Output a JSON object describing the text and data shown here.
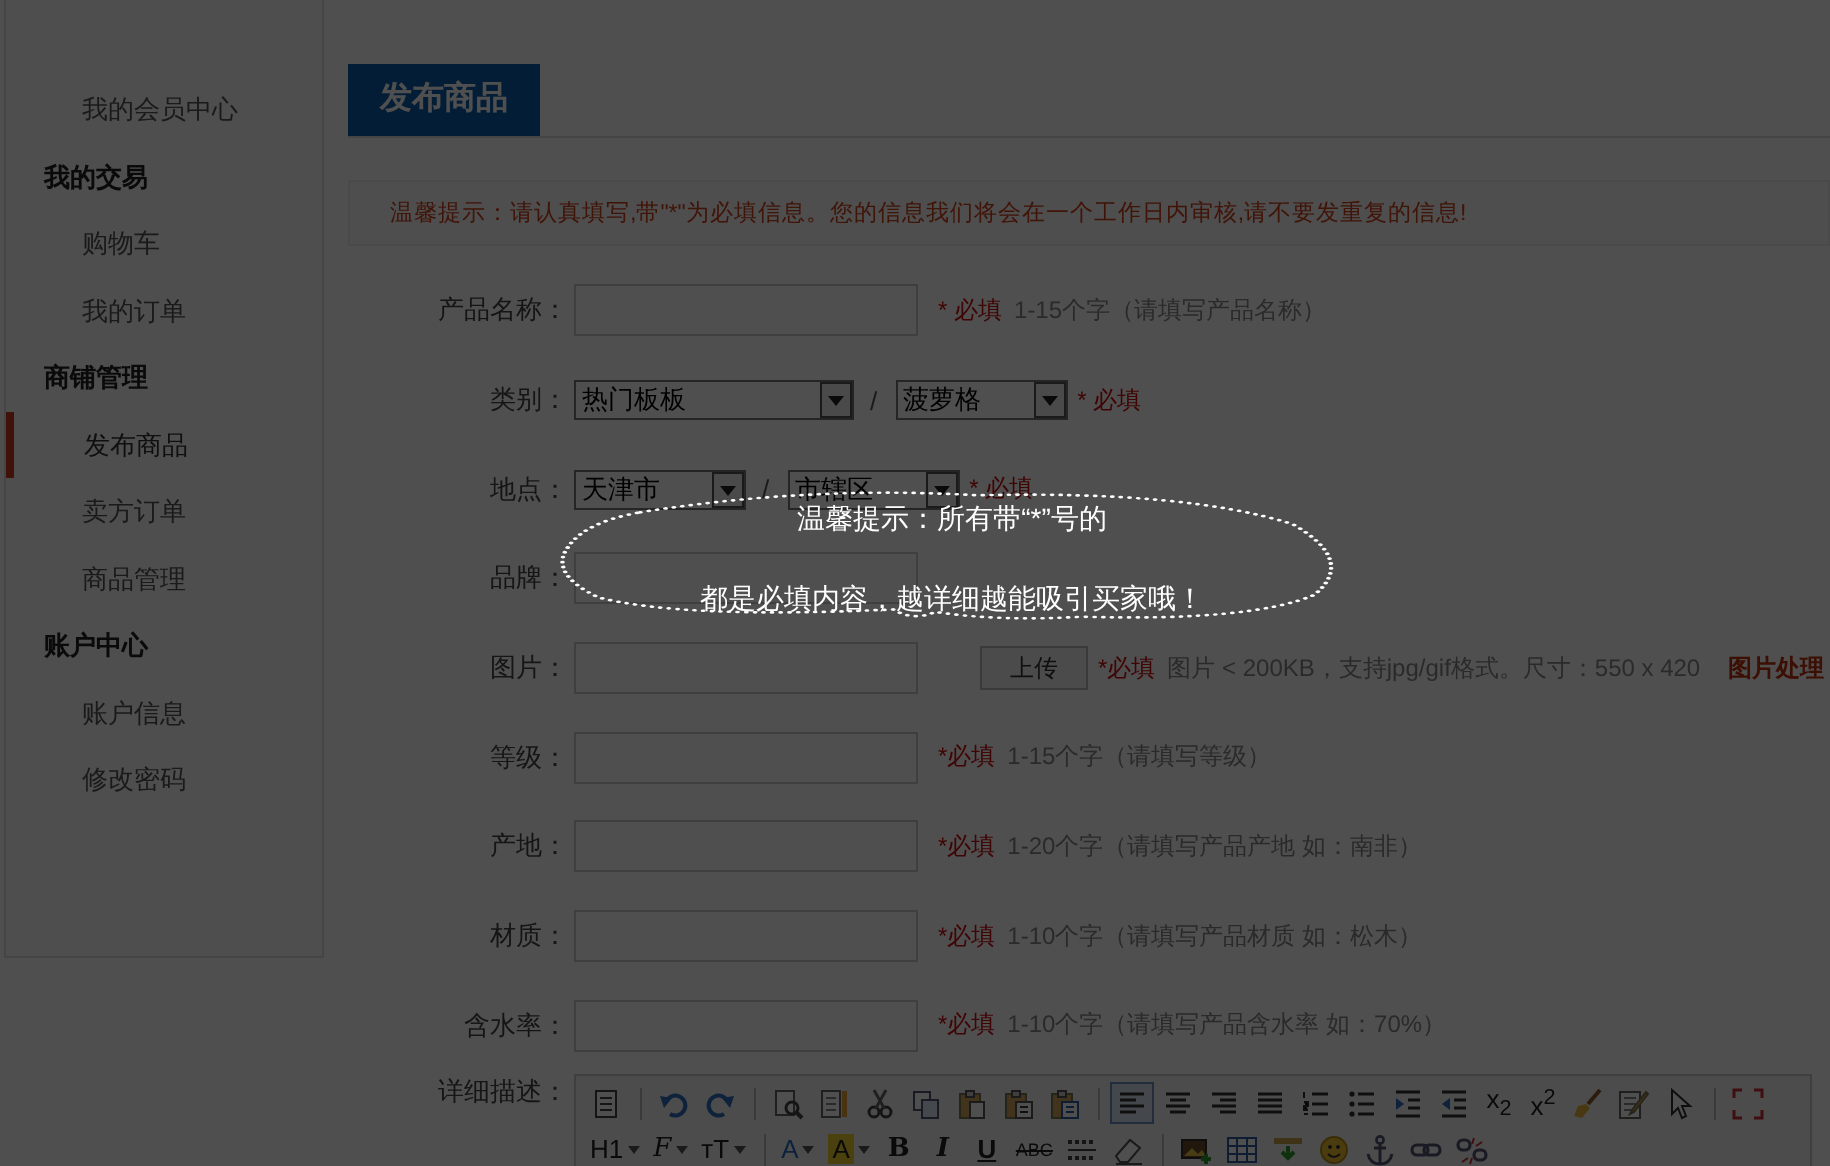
{
  "sidebar": {
    "items": [
      {
        "kind": "link",
        "label": "我的会员中心",
        "selected": false
      },
      {
        "kind": "group",
        "label": "我的交易",
        "children": [
          {
            "label": "购物车",
            "selected": false
          },
          {
            "label": "我的订单",
            "selected": false
          }
        ]
      },
      {
        "kind": "group",
        "label": "商铺管理",
        "children": [
          {
            "label": "发布商品",
            "selected": true
          },
          {
            "label": "卖方订单",
            "selected": false
          },
          {
            "label": "商品管理",
            "selected": false
          }
        ]
      },
      {
        "kind": "group",
        "label": "账户中心",
        "children": [
          {
            "label": "账户信息",
            "selected": false
          },
          {
            "label": "修改密码",
            "selected": false
          }
        ]
      }
    ]
  },
  "header": {
    "tab": "发布商品"
  },
  "notice": "温馨提示：请认真填写,带\"*\"为必填信息。您的信息我们将会在一个工作日内审核,请不要发重复的信息!",
  "form": {
    "rows": [
      {
        "kind": "text",
        "label": "产品名称：",
        "required": "* 必填",
        "hint": "1-15个字（请填写产品名称）"
      },
      {
        "kind": "select",
        "label": "类别：",
        "selects": [
          "热门板板",
          "菠萝格"
        ],
        "separator": "/",
        "required": "* 必填"
      },
      {
        "kind": "select",
        "label": "地点：",
        "selects": [
          "天津市",
          "市辖区"
        ],
        "separator": "/",
        "required": "* 必填"
      },
      {
        "kind": "text",
        "label": "品牌："
      },
      {
        "kind": "upload",
        "label": "图片：",
        "button": "上传",
        "required": "*必填",
        "hint": "图片 < 200KB，支持jpg/gif格式。尺寸：550 x 420",
        "link": "图片处理"
      },
      {
        "kind": "text",
        "label": "等级：",
        "required": "*必填",
        "hint": "1-15个字（请填写等级）"
      },
      {
        "kind": "text",
        "label": "产地：",
        "required": "*必填",
        "hint": "1-20个字（请填写产品产地 如：南非）"
      },
      {
        "kind": "text",
        "label": "材质：",
        "required": "*必填",
        "hint": "1-10个字（请填写产品材质 如：松木）"
      },
      {
        "kind": "text",
        "label": "含水率：",
        "required": "*必填",
        "hint": "1-10个字（请填写产品含水率 如：70%）"
      }
    ]
  },
  "editor": {
    "label": "详细描述：",
    "toolbar": [
      [
        {
          "kind": "source",
          "selected": false
        },
        {
          "kind": "sep"
        },
        {
          "kind": "undo",
          "selected": false
        },
        {
          "kind": "redo",
          "selected": false
        },
        {
          "kind": "sep"
        },
        {
          "kind": "preview",
          "selected": false
        },
        {
          "kind": "template",
          "selected": false
        },
        {
          "kind": "cut",
          "selected": false
        },
        {
          "kind": "copy",
          "selected": false
        },
        {
          "kind": "paste",
          "selected": false
        },
        {
          "kind": "paste-text",
          "selected": false
        },
        {
          "kind": "paste-word",
          "selected": false
        },
        {
          "kind": "sep"
        },
        {
          "kind": "align-left",
          "selected": true
        },
        {
          "kind": "align-center",
          "selected": false
        },
        {
          "kind": "align-right",
          "selected": false
        },
        {
          "kind": "justify",
          "selected": false
        },
        {
          "kind": "ordered-list",
          "selected": false
        },
        {
          "kind": "bullet-list",
          "selected": false
        },
        {
          "kind": "indent",
          "selected": false
        },
        {
          "kind": "outdent",
          "selected": false
        },
        {
          "kind": "text",
          "label": "x$_{2}$",
          "selected": false
        },
        {
          "kind": "text",
          "label": "x$^{2}$",
          "selected": false
        },
        {
          "kind": "brush",
          "selected": false
        },
        {
          "kind": "edit",
          "selected": false
        },
        {
          "kind": "pointer",
          "selected": false
        },
        {
          "kind": "sep"
        },
        {
          "kind": "fullscreen",
          "selected": false
        }
      ],
      [
        {
          "kind": "text",
          "label": "H1",
          "dropdown": true,
          "selected": false
        },
        {
          "kind": "script",
          "label": "F",
          "dropdown": true,
          "selected": false
        },
        {
          "kind": "text",
          "label": "ᴛT",
          "dropdown": true,
          "selected": false
        },
        {
          "kind": "sep"
        },
        {
          "kind": "font-color",
          "label": "A",
          "dropdown": true,
          "selected": false
        },
        {
          "kind": "highlight",
          "label": "A",
          "dropdown": true,
          "selected": false
        },
        {
          "kind": "bold",
          "label": "B",
          "selected": false
        },
        {
          "kind": "italic",
          "label": "I",
          "selected": false
        },
        {
          "kind": "underline",
          "label": "U",
          "selected": false
        },
        {
          "kind": "strike",
          "label": "ABC",
          "selected": false
        },
        {
          "kind": "dotted-rule",
          "selected": false
        },
        {
          "kind": "eraser",
          "selected": false
        },
        {
          "kind": "sep"
        },
        {
          "kind": "image",
          "selected": false
        },
        {
          "kind": "table",
          "selected": false
        },
        {
          "kind": "insert-row",
          "selected": false
        },
        {
          "kind": "smiley",
          "selected": false
        },
        {
          "kind": "anchor",
          "selected": false
        },
        {
          "kind": "link",
          "selected": false
        },
        {
          "kind": "unlink",
          "selected": false
        }
      ]
    ]
  },
  "tip": {
    "lines": [
      "温馨提示：所有带“*”号的",
      "都是必填内容，越详细越能吸引买家哦！"
    ]
  }
}
